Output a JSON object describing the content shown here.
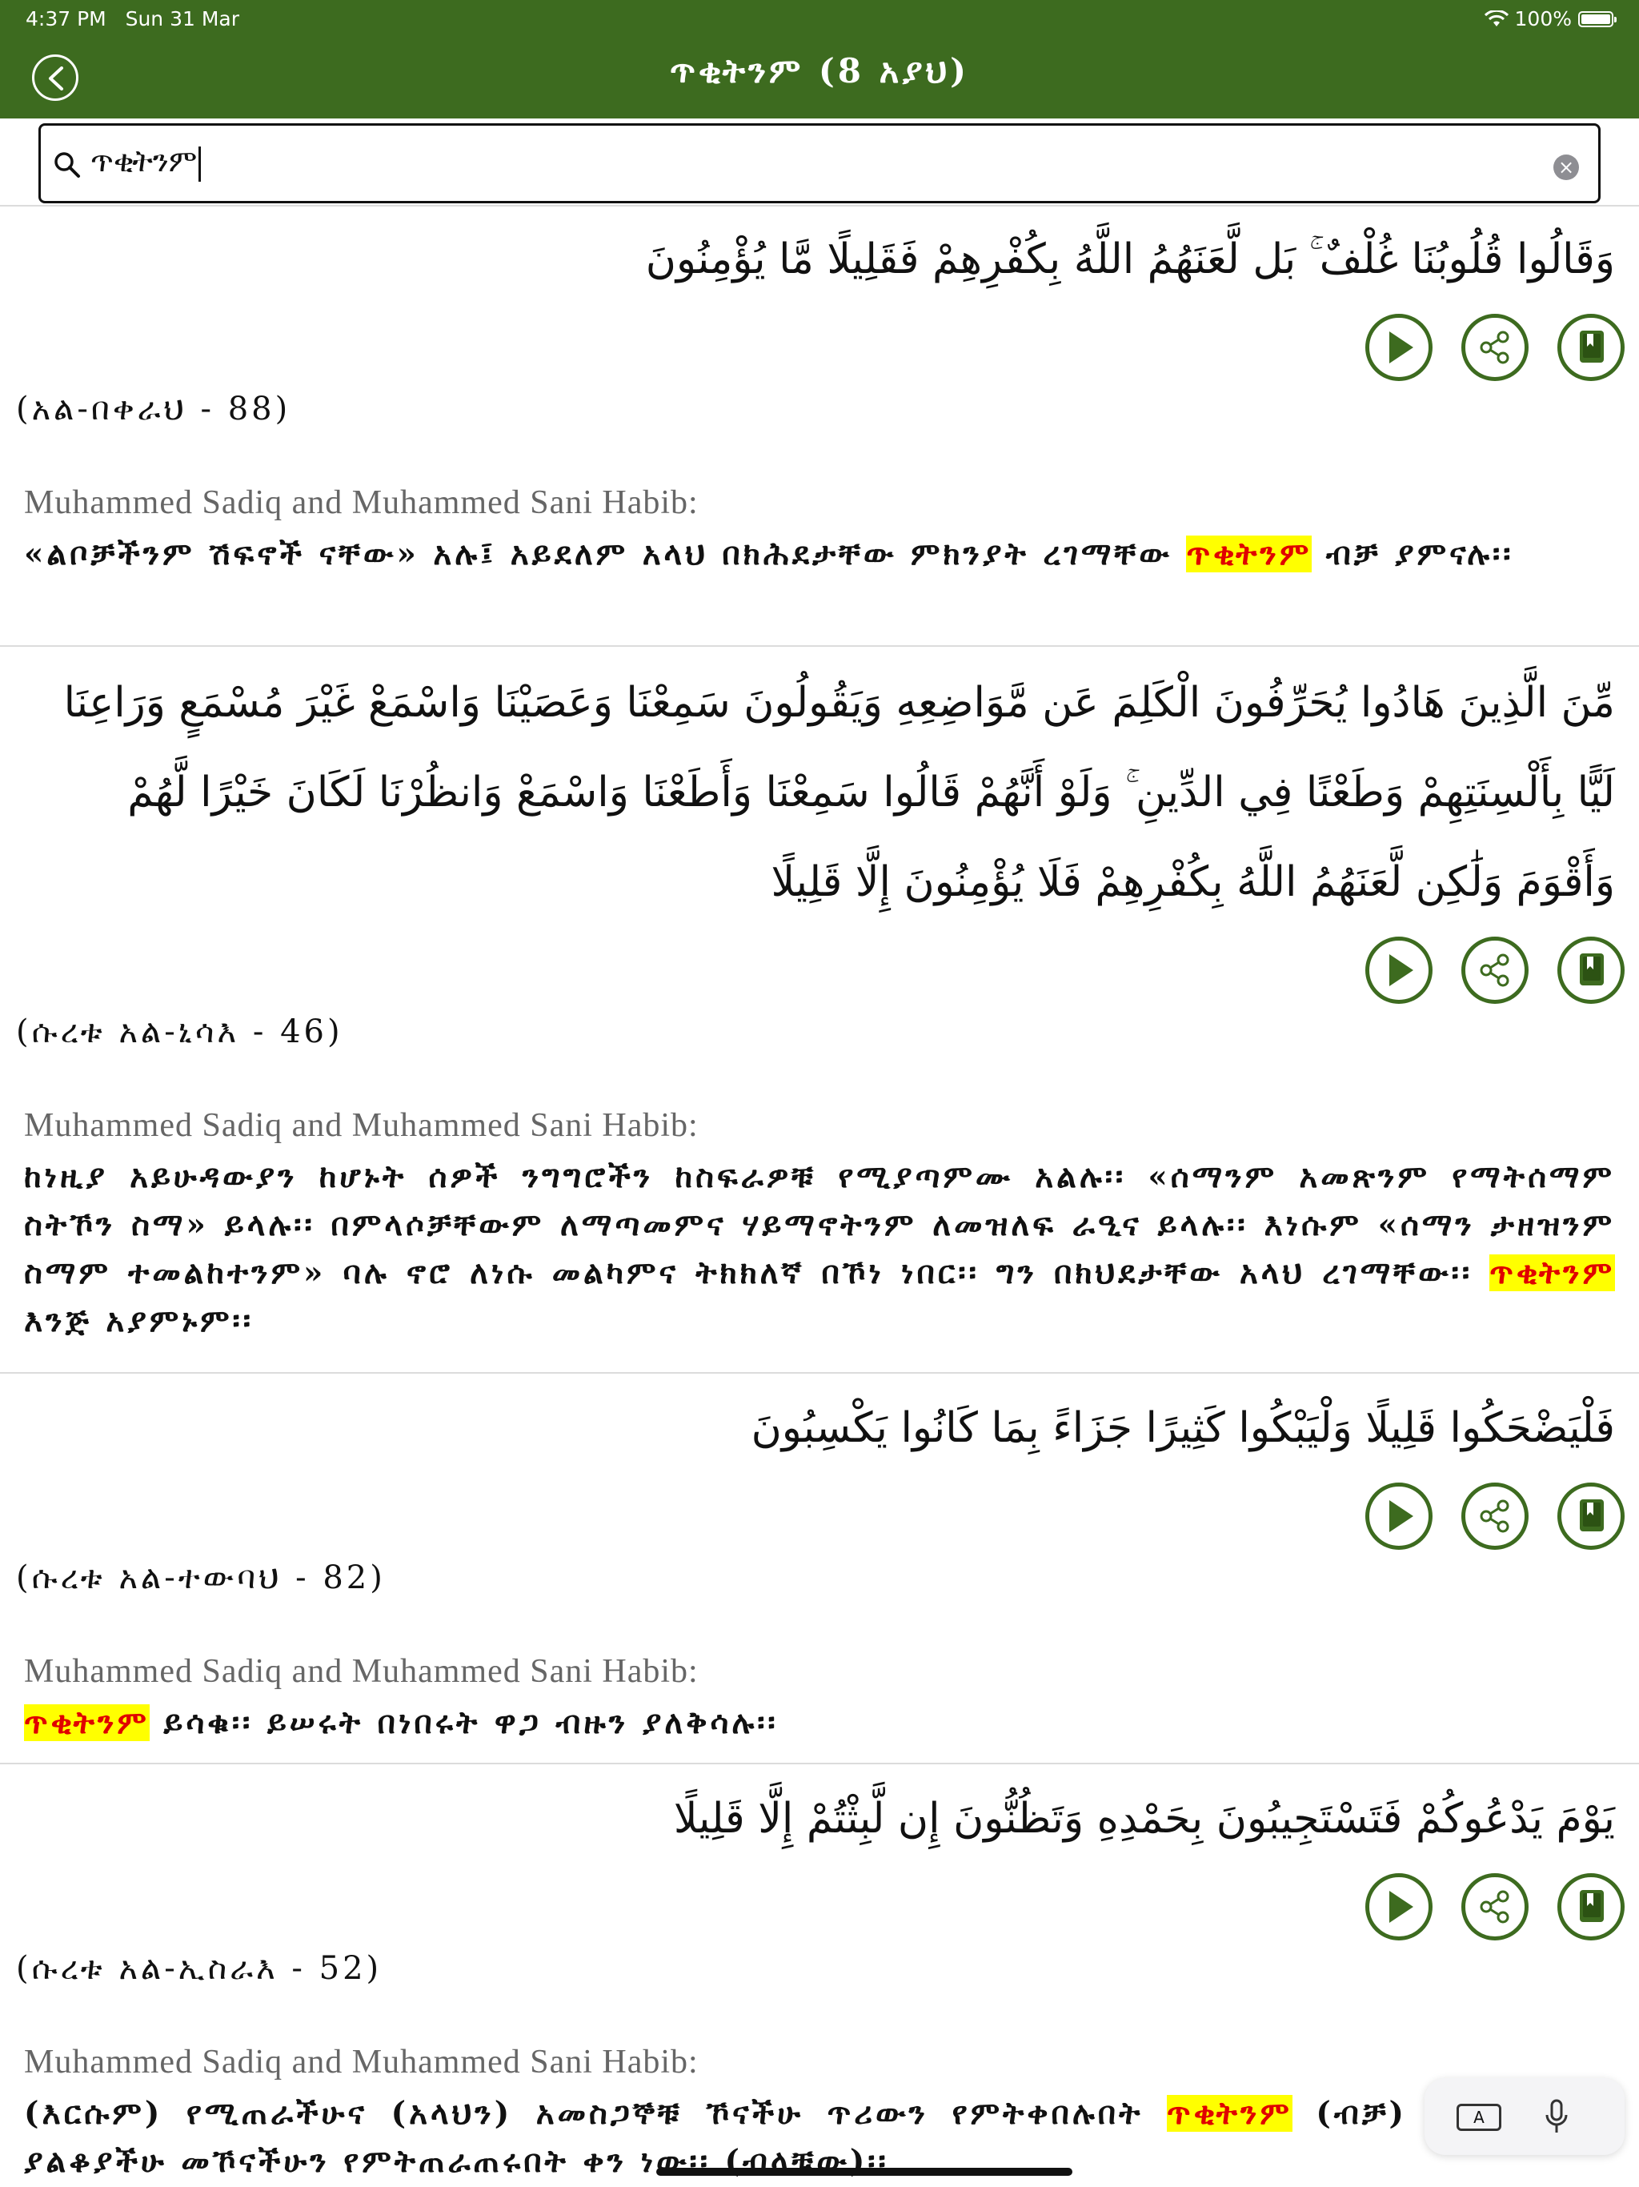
{
  "status_bar": {
    "time": "4:37 PM",
    "date": "Sun 31 Mar",
    "battery": "100%"
  },
  "nav": {
    "title": "ጥቂትንም (8 አያህ)"
  },
  "search": {
    "value": "ጥቂትንም"
  },
  "results": [
    {
      "arabic": "وَقَالُوا قُلُوبُنَا غُلْفٌ ۚ بَل لَّعَنَهُمُ اللَّهُ بِكُفْرِهِمْ فَقَلِيلًا مَّا يُؤْمِنُونَ",
      "reference": "(አል-በቀራህ - 88)",
      "translator": "Muhammed Sadiq and Muhammed Sani Habib:",
      "before": "«ልቦቻችንም ሽፍኖች ናቸው» አሉ፤ አይደለም አላህ በክሕደታቸው ምክንያት ረገማቸው ",
      "highlight": "ጥቂትንም",
      "after": " ብቻ ያምናሉ፡፡"
    },
    {
      "arabic": "مِّنَ الَّذِينَ هَادُوا يُحَرِّفُونَ الْكَلِمَ عَن مَّوَاضِعِهِ وَيَقُولُونَ سَمِعْنَا وَعَصَيْنَا وَاسْمَعْ غَيْرَ مُسْمَعٍ وَرَاعِنَا لَيًّا بِأَلْسِنَتِهِمْ وَطَعْنًا فِي الدِّينِ ۚ وَلَوْ أَنَّهُمْ قَالُوا سَمِعْنَا وَأَطَعْنَا وَاسْمَعْ وَانظُرْنَا لَكَانَ خَيْرًا لَّهُمْ وَأَقْوَمَ وَلَٰكِن لَّعَنَهُمُ اللَّهُ بِكُفْرِهِمْ فَلَا يُؤْمِنُونَ إِلَّا قَلِيلًا",
      "reference": "(ሱረቱ አል-ኒሳእ - 46)",
      "translator": "Muhammed Sadiq and Muhammed Sani Habib:",
      "before": "ከነዚያ አይሁዳውያን ከሆኑት ሰዎች ንግግሮችን ከስፍራዎቹ የሚያጣምሙ አልሉ፡፡ «ሰማንም አመጽንም የማትሰማም ስትኾን ስማ» ይላሉ፡፡ በምላሶቻቸውም ለማጣመምና ሃይማኖትንም ለመዝለፍ ራዒና ይላሉ፡፡ እነሱም «ሰማን ታዘዝንም ስማም ተመልከተንም» ባሉ ኖሮ ለነሱ መልካምና ትክክለኛ በኾነ ነበር፡፡ ግን በክህደታቸው አላህ ረገማቸው፡፡ ",
      "highlight": "ጥቂትንም",
      "after": " እንጅ አያምኑም፡፡"
    },
    {
      "arabic": "فَلْيَضْحَكُوا قَلِيلًا وَلْيَبْكُوا كَثِيرًا جَزَاءً بِمَا كَانُوا يَكْسِبُونَ",
      "reference": "(ሱረቱ አል-ተውባህ - 82)",
      "translator": "Muhammed Sadiq and Muhammed Sani Habib:",
      "before": "",
      "highlight": "ጥቂትንም",
      "after": " ይሳቁ፡፡ ይሠሩት በነበሩት ዋጋ ብዙን ያለቅሳሉ፡፡"
    },
    {
      "arabic": "يَوْمَ يَدْعُوكُمْ فَتَسْتَجِيبُونَ بِحَمْدِهِ وَتَظُنُّونَ إِن لَّبِثْتُمْ إِلَّا قَلِيلًا",
      "reference": "(ሱረቱ አል-ኢስራእ - 52)",
      "translator": "Muhammed Sadiq and Muhammed Sani Habib:",
      "before": "(እርሱም) የሚጠራችሁና (አላህን) አመስጋኞቹ ኾናችሁ ጥሪውን የምትቀበሉበት ",
      "highlight": "ጥቂትንም",
      "after": " (ብቻ) ያልቆያችሁ መኾናችሁን የምትጠራጠሩበት ቀን ነው፡፡ (ብላቹው)፡፡"
    }
  ],
  "icons": {
    "play": "play-icon",
    "share": "share-icon",
    "bookmark": "bookmark-icon"
  },
  "colors": {
    "brand_green": "#3d6b1f",
    "highlight_bg": "#ffff00",
    "highlight_text": "#e00000"
  }
}
